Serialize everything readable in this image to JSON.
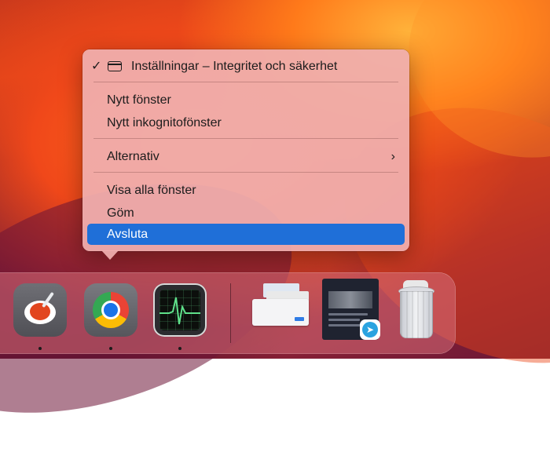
{
  "context_menu": {
    "window_item": "Inställningar – Integritet och säkerhet",
    "window_checked": "✓",
    "new_window": "Nytt fönster",
    "new_incognito_window": "Nytt inkognitofönster",
    "options": "Alternativ",
    "options_chevron": "›",
    "show_all_windows": "Visa alla fönster",
    "hide": "Göm",
    "quit": "Avsluta",
    "highlighted_item": "Avsluta"
  },
  "dock": {
    "apps": [
      {
        "icon": "pasta-app-icon",
        "running": true
      },
      {
        "icon": "chrome-icon",
        "running": true
      },
      {
        "icon": "activity-monitor-icon",
        "running": true
      }
    ],
    "minimized_windows": [
      {
        "icon": "settings-window-thumbnail"
      },
      {
        "icon": "telegram-window-thumbnail",
        "badge_icon": "telegram-icon"
      }
    ],
    "trash": {
      "icon": "trash-full-icon"
    }
  },
  "colors": {
    "menu_highlight": "#1f6fd8",
    "menu_background": "#f0afaf"
  }
}
